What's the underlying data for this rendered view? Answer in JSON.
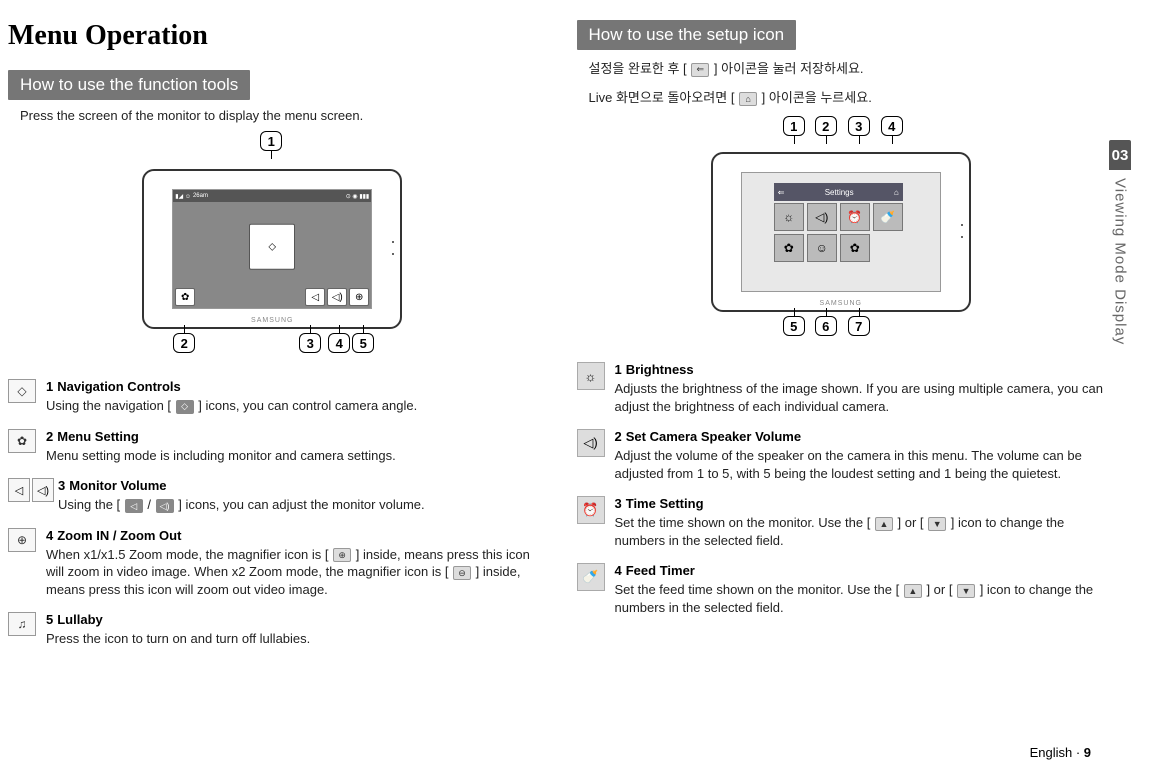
{
  "page_title": "Menu Operation",
  "chapter_number": "03",
  "side_heading": "Viewing Mode Display",
  "footer_language": "English",
  "footer_page": "9",
  "left": {
    "section_header": "How to use the function tools",
    "intro": "Press the screen of the monitor to display the menu screen.",
    "device_status_time": "26am",
    "brand": "SAMSUNG",
    "callouts": [
      "1",
      "2",
      "3",
      "4",
      "5"
    ],
    "items": [
      {
        "num": "1",
        "name": "Navigation Controls",
        "desc_pre": "Using the navigation [ ",
        "desc_post": " ] icons, you can control camera angle.",
        "icon_hint": "nav"
      },
      {
        "num": "2",
        "name": "Menu Setting",
        "desc": "Menu setting mode is including monitor and camera settings."
      },
      {
        "num": "3",
        "name": "Monitor Volume",
        "desc_pre": "Using the [ ",
        "desc_mid": " / ",
        "desc_post": " ] icons, you can adjust the monitor volume."
      },
      {
        "num": "4",
        "name": "Zoom IN / Zoom Out",
        "desc_pre": "When x1/x1.5 Zoom mode, the magnifier icon is [ ",
        "desc_mid": " ] inside, means press this icon will zoom in video image. When x2 Zoom mode, the magnifier icon is [ ",
        "desc_post": " ] inside, means press this icon will zoom out video image."
      },
      {
        "num": "5",
        "name": "Lullaby",
        "desc": "Press the icon to turn on and turn off lullabies."
      }
    ]
  },
  "right": {
    "section_header": "How to use the setup icon",
    "intro1_pre": "설정을 완료한 후 [ ",
    "intro1_post": " ] 아이콘을 눌러 저장하세요.",
    "intro2_pre": "Live 화면으로 돌아오려면 [ ",
    "intro2_post": " ] 아이콘을 누르세요.",
    "settings_label": "Settings",
    "brand": "SAMSUNG",
    "callouts_top": [
      "1",
      "2",
      "3",
      "4"
    ],
    "callouts_bottom": [
      "5",
      "6",
      "7"
    ],
    "items": [
      {
        "num": "1",
        "name": "Brightness",
        "desc": "Adjusts the brightness of the image shown. If you are using multiple camera, you can adjust the brightness of each individual camera."
      },
      {
        "num": "2",
        "name": "Set Camera Speaker Volume",
        "desc": "Adjust the volume of the speaker on the camera in this menu. The volume can be adjusted from 1 to 5, with 5 being the loudest setting and 1 being the quietest."
      },
      {
        "num": "3",
        "name": "Time Setting",
        "desc_pre": "Set the time shown on the monitor. Use the [ ",
        "desc_mid": " ] or [ ",
        "desc_post": " ] icon to change the numbers in the selected field."
      },
      {
        "num": "4",
        "name": "Feed Timer",
        "desc_pre": "Set the feed time shown on the monitor. Use the [ ",
        "desc_mid": " ] or [ ",
        "desc_post": " ] icon to change the numbers in the selected field."
      }
    ]
  }
}
